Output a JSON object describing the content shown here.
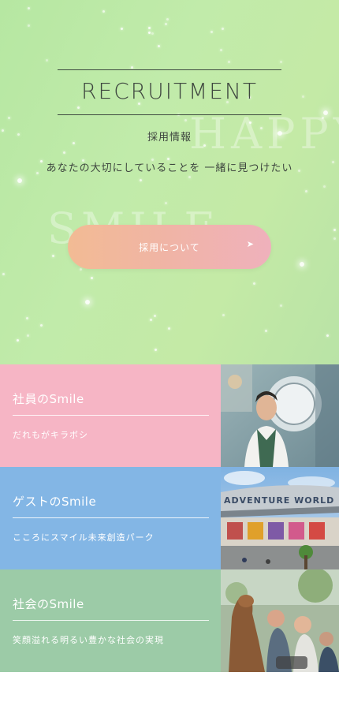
{
  "hero": {
    "title": "RECRUITMENT",
    "subtitle": "採用情報",
    "tagline": "あなたの大切にしていることを 一緒に見つけたい",
    "bg_word_1": "HAPPY",
    "bg_word_2": "SMILE",
    "cta_label": "採用について",
    "cta_icon": "arrow-right-icon"
  },
  "colors": {
    "hero_bg": "#c1ebaa",
    "cta_start": "#f2bb94",
    "cta_end": "#efb1bc",
    "pink": "#f6b5c5",
    "blue": "#83b6e5",
    "green": "#9ccba7"
  },
  "sections": [
    {
      "title": "社員のSmile",
      "desc": "だれもがキラボシ",
      "photo": "staff-photo"
    },
    {
      "title": "ゲストのSmile",
      "desc": "こころにスマイル未来創造パーク",
      "photo": "park-entrance-photo",
      "photo_sign": "ADVENTURE WORLD"
    },
    {
      "title": "社会のSmile",
      "desc": "笑顔溢れる明るい豊かな社会の実現",
      "photo": "alpaca-visitors-photo"
    }
  ]
}
